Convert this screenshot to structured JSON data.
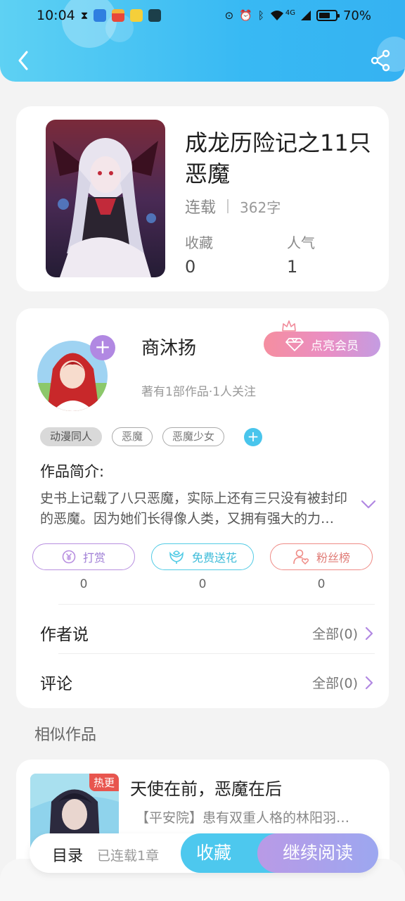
{
  "status_bar": {
    "time": "10:04",
    "network": "4G",
    "battery_percent": "70%",
    "battery_level": 0.7
  },
  "book": {
    "title": "成龙历险记之11只恶魔",
    "status": "连载",
    "word_count": "362字",
    "favorites_label": "收藏",
    "favorites_value": "0",
    "popularity_label": "人气",
    "popularity_value": "1"
  },
  "author": {
    "name": "商沐扬",
    "meta": "著有1部作品·1人关注",
    "vip_button": "点亮会员",
    "follow_glyph": "+"
  },
  "tags": [
    "动漫同人",
    "恶魔",
    "恶魔少女"
  ],
  "tag_add_glyph": "+",
  "intro": {
    "title": "作品简介:",
    "text": "史书上记载了八只恶魔，实际上还有三只没有被封印的恶魔。因为她们长得像人类，又拥有强大的力量……"
  },
  "actions": [
    {
      "label": "打赏",
      "count": "0"
    },
    {
      "label": "免费送花",
      "count": "0"
    },
    {
      "label": "粉丝榜",
      "count": "0"
    }
  ],
  "author_says": {
    "label": "作者说",
    "value": "全部(0)"
  },
  "comments": {
    "label": "评论",
    "value": "全部(0)"
  },
  "similar": {
    "section_title": "相似作品",
    "items": [
      {
        "badge": "热更",
        "title": "天使在前，恶魔在后",
        "desc": "【平安院】患有双重人格的林阳羽…"
      }
    ]
  },
  "bottom_bar": {
    "toc": "目录",
    "chapters": "已连载1章",
    "collect": "收藏",
    "continue": "继续阅读"
  },
  "colors": {
    "header": "#38b9f3",
    "accent_purple": "#b188e2",
    "accent_cyan": "#4dc8ee",
    "accent_red": "#ef8b86"
  },
  "icons": [
    "back-arrow-icon",
    "share-icon",
    "diamond-icon",
    "crown-icon",
    "yuan-coin-icon",
    "flower-icon",
    "user-heart-icon",
    "chevron-right-icon",
    "chevron-down-icon"
  ]
}
